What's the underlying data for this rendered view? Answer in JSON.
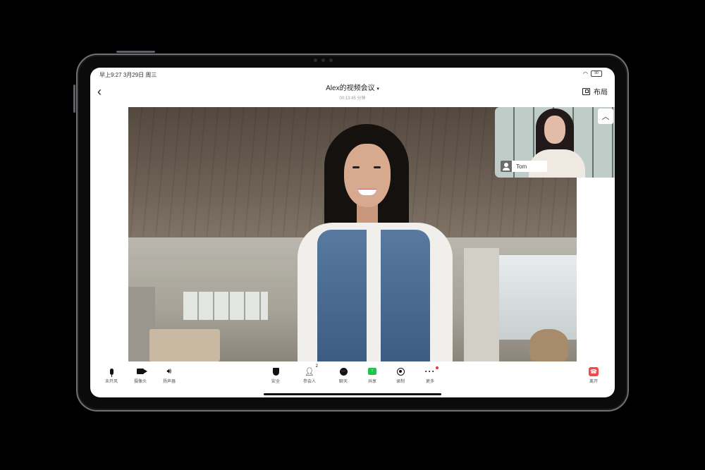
{
  "status_bar": {
    "time": "早上9:27",
    "date": "3月29日",
    "weekday": "周三",
    "battery": "90"
  },
  "header": {
    "back_icon": "chevron-left-icon",
    "title": "Alex的视频会议",
    "subtitle": "00:13:45 分钟",
    "layout_label": "布局",
    "layout_icon": "layout-icon"
  },
  "participants": {
    "main": {
      "label": ""
    },
    "pip": {
      "name": "Tom"
    }
  },
  "toolbar": {
    "items": [
      {
        "label": "未开风",
        "icon": "microphone-icon"
      },
      {
        "label": "摄像头",
        "icon": "camera-icon"
      },
      {
        "label": "扬声器",
        "icon": "speaker-icon"
      },
      {
        "label": "安全",
        "icon": "shield-icon"
      },
      {
        "label": "参会人",
        "icon": "participants-icon",
        "count": "2"
      },
      {
        "label": "聊天",
        "icon": "chat-icon"
      },
      {
        "label": "共享",
        "icon": "share-screen-icon"
      },
      {
        "label": "录制",
        "icon": "record-icon"
      },
      {
        "label": "更多",
        "icon": "more-icon"
      },
      {
        "label": "离开",
        "icon": "leave-icon"
      }
    ]
  },
  "colors": {
    "share_green": "#1fc24a",
    "leave_red": "#f04a4a",
    "notification_dot": "#e33333"
  }
}
